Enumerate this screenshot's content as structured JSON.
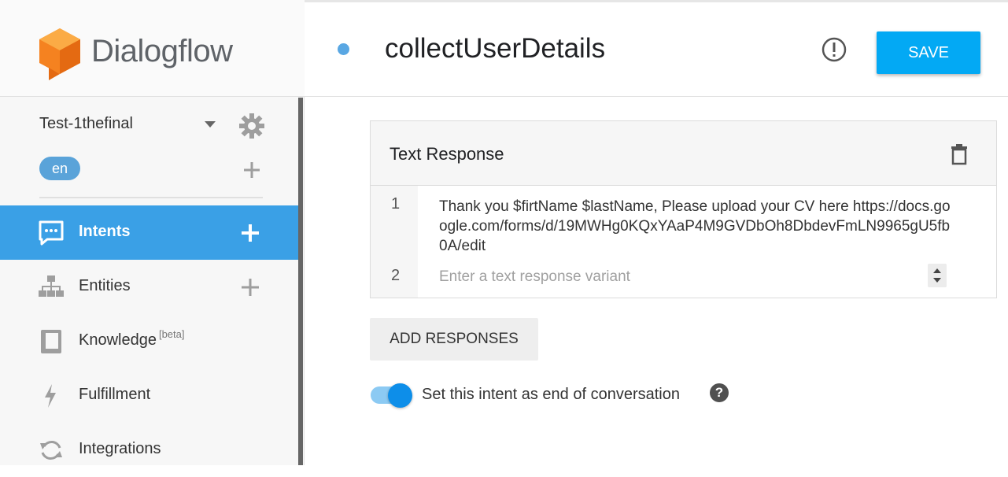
{
  "app": {
    "logo_text": "Dialogflow"
  },
  "agent": {
    "name": "Test-1thefinal",
    "language": "en"
  },
  "sidebar": {
    "items": [
      {
        "label": "Intents",
        "active": true,
        "icon": "chat-bubble-icon",
        "has_add": true
      },
      {
        "label": "Entities",
        "active": false,
        "icon": "hierarchy-icon",
        "has_add": true
      },
      {
        "label": "Knowledge",
        "badge": "[beta]",
        "active": false,
        "icon": "book-icon",
        "has_add": false
      },
      {
        "label": "Fulfillment",
        "active": false,
        "icon": "lightning-icon",
        "has_add": false
      },
      {
        "label": "Integrations",
        "active": false,
        "icon": "sync-icon",
        "has_add": false
      }
    ]
  },
  "header": {
    "intent_name": "collectUserDetails",
    "save_label": "SAVE"
  },
  "response_card": {
    "title": "Text Response",
    "rows": [
      {
        "num": "1",
        "text": "Thank you $firtName $lastName, Please upload your CV here https://docs.google.com/forms/d/19MWHg0KQxYAaP4M9GVDbOh8DbdevFmLN9965gU5fb0A/edit"
      },
      {
        "num": "2",
        "placeholder": "Enter a text response variant"
      }
    ]
  },
  "add_responses_label": "ADD RESPONSES",
  "end_of_conversation": {
    "label": "Set this intent as end of conversation",
    "enabled": true,
    "help": "?"
  },
  "colors": {
    "accent": "#03a9f4",
    "active_nav": "#3aa0e6",
    "logo_orange": "#f58220"
  }
}
